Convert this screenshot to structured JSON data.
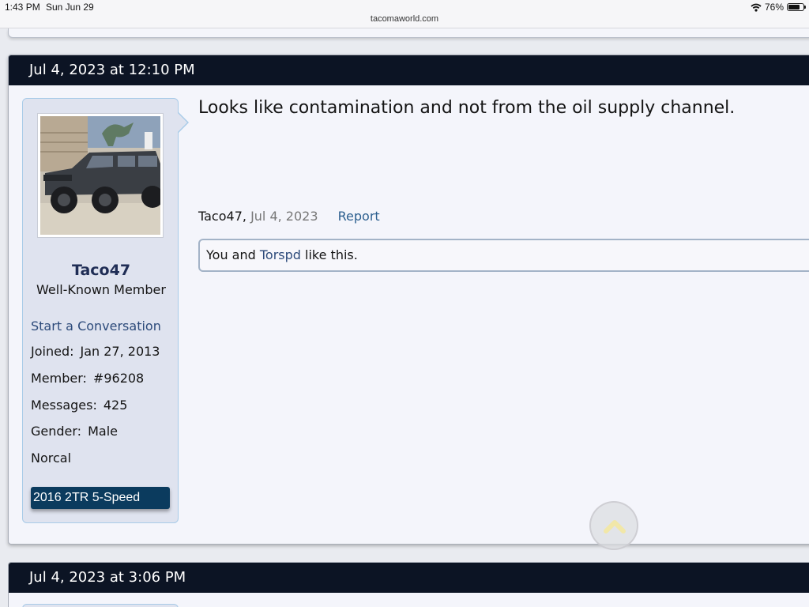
{
  "status_bar": {
    "time": "1:43 PM",
    "date": "Sun Jun 29",
    "url": "tacomaworld.com",
    "battery": "76%",
    "battery_level": 0.76,
    "wifi_icon": "wifi-icon",
    "battery_icon": "battery-icon"
  },
  "post": {
    "timestamp": "Jul 4, 2023 at 12:10 PM",
    "message": "Looks like contamination and not from the oil supply channel.",
    "author_meta": "Taco47,",
    "date_meta": "Jul 4, 2023",
    "report_label": "Report",
    "likes": {
      "prefix": "You and",
      "liker": "Torspd",
      "suffix": "like this."
    }
  },
  "user": {
    "username": "Taco47",
    "title": "Well-Known Member",
    "start_conversation": "Start a Conversation",
    "stats": [
      {
        "label": "Joined:",
        "value": "Jan 27, 2013"
      },
      {
        "label": "Member:",
        "value": "#96208"
      },
      {
        "label": "Messages:",
        "value": "425"
      },
      {
        "label": "Gender:",
        "value": "Male"
      }
    ],
    "location": "Norcal",
    "vehicle": "2016 2TR 5-Speed"
  },
  "next_post": {
    "timestamp": "Jul 4, 2023 at 3:06 PM"
  },
  "colors": {
    "header_bg": "#0c1424",
    "link": "#2c4a7a",
    "badge_bg": "#0b3b5e",
    "panel_bg": "#dfe3ef"
  },
  "icons": {
    "scroll_top": "chevron-up-icon"
  }
}
